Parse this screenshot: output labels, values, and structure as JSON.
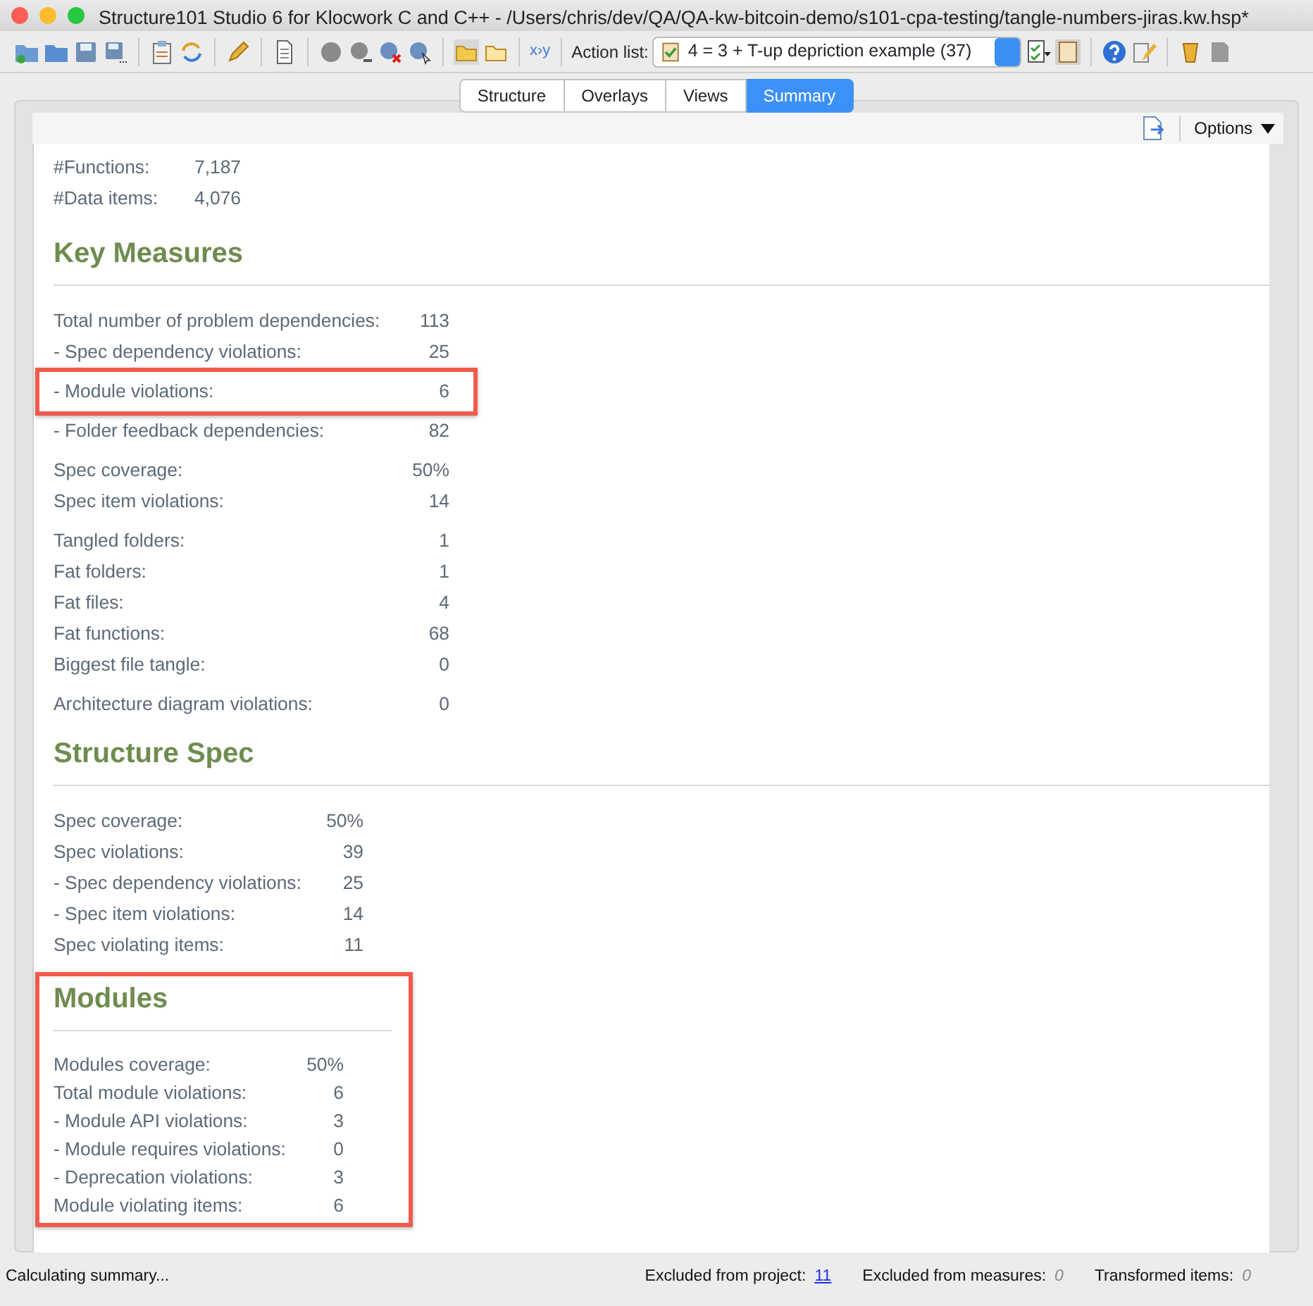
{
  "window": {
    "title": "Structure101 Studio 6 for Klocwork C and C++ - /Users/chris/dev/QA/QA-kw-bitcoin-demo/s101-cpa-testing/tangle-numbers-jiras.kw.hsp*"
  },
  "toolbar": {
    "xy_button": "x›y",
    "action_list_label": "Action list:",
    "action_list_value": "4 = 3 + T-up depriction example (37)"
  },
  "tabs": [
    {
      "label": "Structure",
      "selected": false
    },
    {
      "label": "Overlays",
      "selected": false
    },
    {
      "label": "Views",
      "selected": false
    },
    {
      "label": "Summary",
      "selected": true
    }
  ],
  "options_button": "Options",
  "counts": [
    {
      "label": "#Functions:",
      "value": "7,187"
    },
    {
      "label": "#Data items:",
      "value": "4,076"
    }
  ],
  "sections": [
    {
      "title": "Key Measures",
      "highlighted": false,
      "groups": [
        [
          {
            "label": "Total number of problem dependencies:",
            "value": "113",
            "highlighted": false
          },
          {
            "label": "- Spec dependency violations:",
            "value": "25",
            "highlighted": false
          },
          {
            "label": "- Module violations:",
            "value": "6",
            "highlighted": true
          },
          {
            "label": "- Folder feedback dependencies:",
            "value": "82",
            "highlighted": false
          }
        ],
        [
          {
            "label": "Spec coverage:",
            "value": "50%",
            "highlighted": false
          },
          {
            "label": "Spec item violations:",
            "value": "14",
            "highlighted": false
          }
        ],
        [
          {
            "label": "Tangled folders:",
            "value": "1",
            "highlighted": false
          },
          {
            "label": "Fat folders:",
            "value": "1",
            "highlighted": false
          },
          {
            "label": "Fat files:",
            "value": "4",
            "highlighted": false
          },
          {
            "label": "Fat functions:",
            "value": "68",
            "highlighted": false
          },
          {
            "label": "Biggest file tangle:",
            "value": "0",
            "highlighted": false
          }
        ],
        [
          {
            "label": "Architecture diagram violations:",
            "value": "0",
            "highlighted": false
          }
        ]
      ]
    },
    {
      "title": "Structure Spec",
      "highlighted": false,
      "groups": [
        [
          {
            "label": "Spec coverage:",
            "value": "50%",
            "highlighted": false
          },
          {
            "label": "Spec violations:",
            "value": "39",
            "highlighted": false
          },
          {
            "label": "- Spec dependency violations:",
            "value": "25",
            "highlighted": false
          },
          {
            "label": "- Spec item violations:",
            "value": "14",
            "highlighted": false
          },
          {
            "label": "Spec violating items:",
            "value": "11",
            "highlighted": false
          }
        ]
      ]
    },
    {
      "title": "Modules",
      "highlighted": true,
      "groups": [
        [
          {
            "label": "Modules coverage:",
            "value": "50%",
            "highlighted": false
          },
          {
            "label": "Total module violations:",
            "value": "6",
            "highlighted": false
          },
          {
            "label": "- Module API violations:",
            "value": "3",
            "highlighted": false
          },
          {
            "label": "- Module requires violations:",
            "value": "0",
            "highlighted": false
          },
          {
            "label": "- Deprecation violations:",
            "value": "3",
            "highlighted": false
          },
          {
            "label": "Module violating items:",
            "value": "6",
            "highlighted": false
          }
        ]
      ]
    }
  ],
  "status_bar": {
    "message": "Calculating summary...",
    "items": [
      {
        "label": "Excluded from project:",
        "value": "11",
        "kind": "link"
      },
      {
        "label": "Excluded from measures:",
        "value": "0",
        "kind": "muted"
      },
      {
        "label": "Transformed items:",
        "value": "0",
        "kind": "muted"
      }
    ]
  }
}
